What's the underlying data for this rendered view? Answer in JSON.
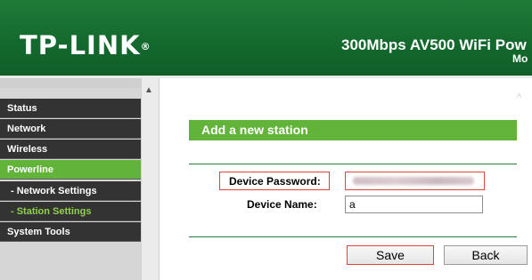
{
  "header": {
    "logo": "TP-LINK",
    "logo_mark": "®",
    "product_title": "300Mbps AV500 WiFi Pow",
    "model_label": "Mo"
  },
  "sidebar": {
    "items": [
      {
        "label": "Status"
      },
      {
        "label": "Network"
      },
      {
        "label": "Wireless"
      },
      {
        "label": "Powerline"
      },
      {
        "label": "- Network Settings"
      },
      {
        "label": "- Station Settings"
      },
      {
        "label": "System Tools"
      }
    ],
    "active_item": "Powerline",
    "active_subitem": "- Station Settings"
  },
  "main": {
    "section_title": "Add a new station",
    "fields": {
      "password_label": "Device Password:",
      "name_label": "Device Name:",
      "name_value": "a"
    },
    "buttons": {
      "save": "Save",
      "back": "Back"
    }
  },
  "icons": {
    "sidebar_scroll_up": "chevron-up-icon",
    "main_scroll_up": "chevron-up-icon"
  },
  "colors": {
    "header_green": "#146a2e",
    "accent_green": "#62b33a",
    "menu_dark": "#333333",
    "highlight_red": "#e0453c"
  }
}
